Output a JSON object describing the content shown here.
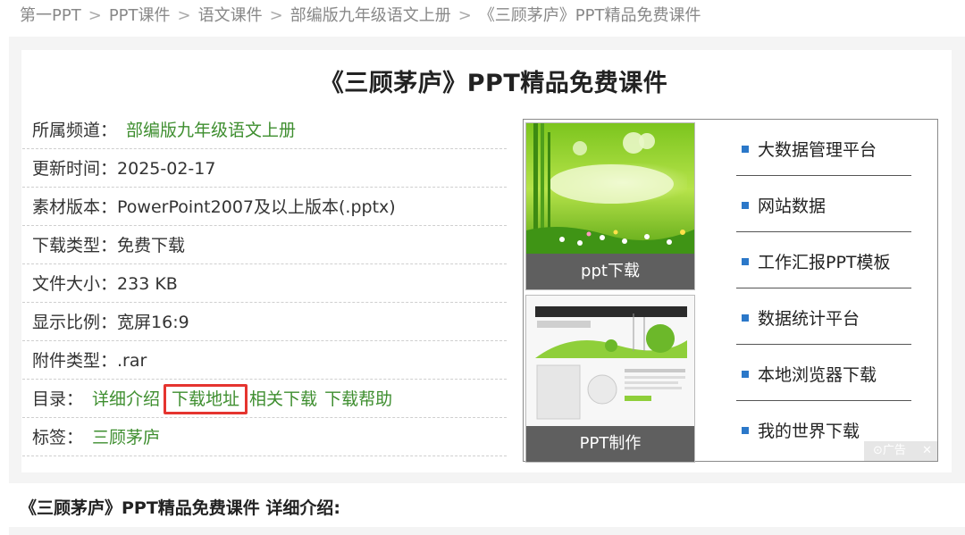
{
  "breadcrumb": {
    "items": [
      "第一PPT",
      "PPT课件",
      "语文课件",
      "部编版九年级语文上册",
      "《三顾茅庐》PPT精品免费课件"
    ],
    "separator": ">"
  },
  "page": {
    "title": "《三顾茅庐》PPT精品免费课件"
  },
  "info": {
    "channel_label": "所属频道：",
    "channel_value": "部编版九年级语文上册",
    "update_label": "更新时间：",
    "update_value": "2025-02-17",
    "version_label": "素材版本：",
    "version_value": "PowerPoint2007及以上版本(.pptx)",
    "download_type_label": "下载类型：",
    "download_type_value": "免费下载",
    "size_label": "文件大小：",
    "size_value": "233 KB",
    "ratio_label": "显示比例：",
    "ratio_value": "宽屏16:9",
    "attach_label": "附件类型：",
    "attach_value": ".rar",
    "toc_label": "目录：",
    "toc_links": [
      "详细介绍",
      "下载地址",
      "相关下载",
      "下载帮助"
    ],
    "tags_label": "标签：",
    "tags_value": "三顾茅庐"
  },
  "ad": {
    "thumb1_caption": "ppt下载",
    "thumb2_caption": "PPT制作",
    "links": [
      "大数据管理平台",
      "网站数据",
      "工作汇报PPT模板",
      "数据统计平台",
      "本地浏览器下载",
      "我的世界下载"
    ],
    "badge_text": "广告",
    "close_symbol": "✕",
    "bullet_color": "#2b78c9"
  },
  "detail": {
    "heading": "《三顾茅庐》PPT精品免费课件 详细介绍:"
  },
  "colors": {
    "link_green": "#3e8e2f",
    "highlight_red": "#e5342f",
    "caption_bg": "#5f5f5f"
  }
}
